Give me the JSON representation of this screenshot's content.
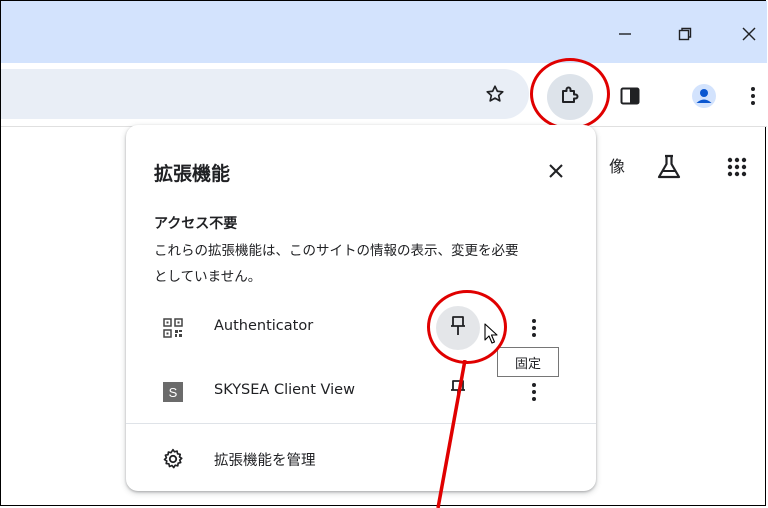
{
  "popup": {
    "title": "拡張機能",
    "section_heading": "アクセス不要",
    "section_desc_line1": "これらの拡張機能は、このサイトの情報の表示、変更を必要",
    "section_desc_line2": "としていません。",
    "extensions": [
      {
        "name": "Authenticator",
        "icon": "qr-code-icon"
      },
      {
        "name": "SKYSEA Client View",
        "icon": "s-letter-icon",
        "icon_letter": "S"
      }
    ],
    "manage_label": "拡張機能を管理"
  },
  "tooltip": {
    "text": "固定"
  },
  "background": {
    "partial_text": "像"
  },
  "colors": {
    "titlebar": "#d3e3fd",
    "omnibox": "#e9eef6",
    "annotation_red": "#e00000",
    "avatar_blue": "#0b57d0"
  }
}
